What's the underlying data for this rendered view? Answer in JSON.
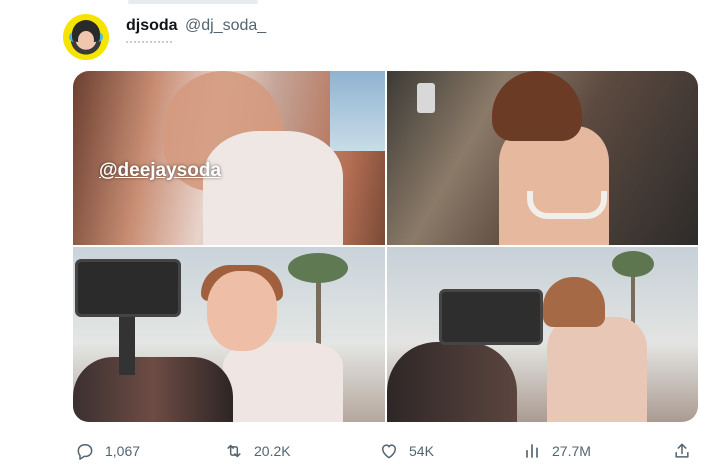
{
  "tweet": {
    "author": {
      "display_name": "djsoda",
      "handle": "@dj_soda_"
    },
    "media": {
      "count": 4,
      "watermark": "@deejaysoda"
    },
    "actions": {
      "reply_count": "1,067",
      "retweet_count": "20.2K",
      "like_count": "54K",
      "view_count": "27.7M"
    }
  },
  "icons": {
    "reply": "reply-icon",
    "retweet": "retweet-icon",
    "like": "heart-icon",
    "views": "analytics-icon",
    "share": "share-icon"
  },
  "colors": {
    "text_primary": "#0f1419",
    "text_secondary": "#536471"
  }
}
